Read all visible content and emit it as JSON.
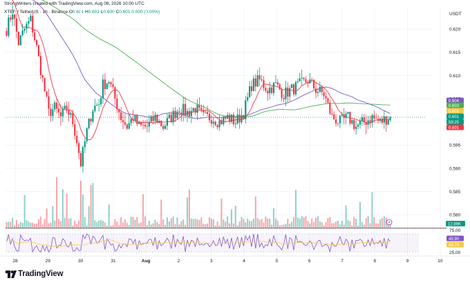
{
  "header": {
    "credit": "StrongWriters created with TradingView.com, Aug 08, 2026 10:00 UTC",
    "symbol": "XTER / TetherUS · 1h · Binance",
    "open_label": "O",
    "open": "0.601",
    "high_label": "H",
    "high": "0.601",
    "low_label": "L",
    "low": "0.600",
    "close_label": "C",
    "close": "0.601",
    "change": "0.000 (0.00%)"
  },
  "price_axis": {
    "currency": "USDT"
  },
  "footer": {
    "brand": "TradingView"
  },
  "colors": {
    "up": "#089981",
    "down": "#f23645",
    "ma_fast": "#f23645",
    "ma_mid": "#7e57c2",
    "ma_slow": "#4caf50",
    "rsi": "#7e57c2"
  },
  "chart_data": {
    "type": "candlestick",
    "price_ticks": [
      0.62,
      0.615,
      0.61,
      0.605,
      0.6,
      0.595,
      0.59,
      0.585,
      0.58
    ],
    "ylim": [
      0.5775,
      0.6248
    ],
    "x_ticks": [
      "28",
      "29",
      "30",
      "31",
      "Aug",
      "2",
      "3",
      "4",
      "5",
      "6",
      "7",
      "8",
      "9",
      "10"
    ],
    "price_tags": [
      {
        "value": "0.604",
        "color": "#7e57c2"
      },
      {
        "value": "0.603",
        "color": "#4caf50"
      },
      {
        "value": "0.601",
        "color": "#f7c948"
      },
      {
        "value": "0.601",
        "color": "#089981"
      },
      {
        "value": "59:25",
        "color": "#089981"
      },
      {
        "value": "0.601",
        "color": "#f23645"
      }
    ],
    "volume_tag": "12.89K",
    "rsi": {
      "ticks": [
        "75.00",
        "25.00"
      ],
      "tags": [
        {
          "value": "49.90",
          "color": "#7e57c2"
        },
        {
          "value": "49.79",
          "color": "#f7c948"
        }
      ]
    },
    "anchors": [
      [
        0,
        0.62
      ],
      [
        3,
        0.624
      ],
      [
        6,
        0.617
      ],
      [
        9,
        0.62
      ],
      [
        12,
        0.622
      ],
      [
        15,
        0.616
      ],
      [
        18,
        0.609
      ],
      [
        21,
        0.602
      ],
      [
        24,
        0.603
      ],
      [
        27,
        0.601
      ],
      [
        30,
        0.603
      ],
      [
        33,
        0.6
      ],
      [
        35,
        0.596
      ],
      [
        37,
        0.591
      ],
      [
        40,
        0.598
      ],
      [
        43,
        0.603
      ],
      [
        46,
        0.604
      ],
      [
        48,
        0.608
      ],
      [
        51,
        0.609
      ],
      [
        54,
        0.605
      ],
      [
        57,
        0.601
      ],
      [
        60,
        0.599
      ],
      [
        63,
        0.601
      ],
      [
        66,
        0.599
      ],
      [
        70,
        0.599
      ],
      [
        74,
        0.601
      ],
      [
        78,
        0.599
      ],
      [
        82,
        0.601
      ],
      [
        86,
        0.603
      ],
      [
        90,
        0.602
      ],
      [
        94,
        0.603
      ],
      [
        98,
        0.601
      ],
      [
        102,
        0.601
      ],
      [
        106,
        0.6
      ],
      [
        110,
        0.601
      ],
      [
        114,
        0.6
      ],
      [
        118,
        0.602
      ],
      [
        122,
        0.608
      ],
      [
        126,
        0.609
      ],
      [
        130,
        0.607
      ],
      [
        134,
        0.608
      ],
      [
        138,
        0.606
      ],
      [
        142,
        0.607
      ],
      [
        146,
        0.608
      ],
      [
        150,
        0.609
      ],
      [
        154,
        0.607
      ],
      [
        158,
        0.606
      ],
      [
        162,
        0.601
      ],
      [
        166,
        0.6
      ],
      [
        170,
        0.601
      ],
      [
        174,
        0.599
      ],
      [
        178,
        0.6
      ],
      [
        182,
        0.601
      ],
      [
        186,
        0.6
      ],
      [
        190,
        0.601
      ]
    ]
  }
}
